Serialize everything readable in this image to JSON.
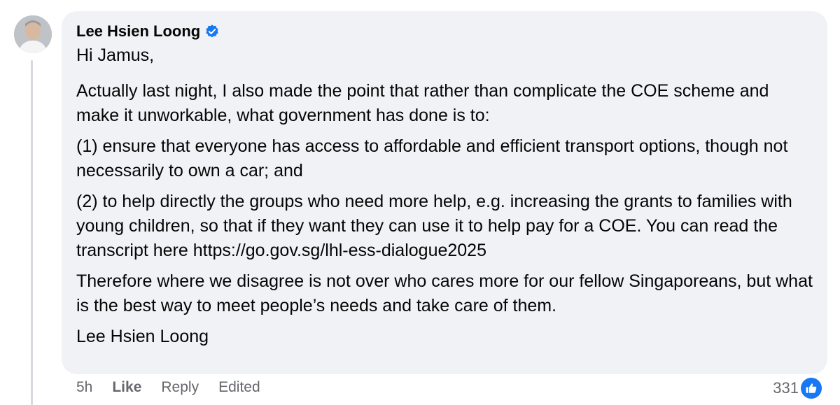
{
  "comment": {
    "author": "Lee Hsien Loong",
    "verified_icon": "verified-badge-icon",
    "paragraphs": [
      "Hi Jamus,",
      "Actually last night, I also made the point that rather than complicate the COE scheme and make it unworkable, what government has done is to:",
      "(1) ensure that everyone has access to affordable and efficient transport options, though not necessarily to own a car; and",
      "(2) to help directly the groups who need more help, e.g. increasing the grants to families with young children, so that if they want they can use it to help pay for a COE. You can read the transcript here https://go.gov.sg/lhl-ess-dialogue2025",
      "Therefore where we disagree is not over who cares more for our fellow Singaporeans, but what is the best way to meet people’s needs and take care of them.",
      "Lee Hsien Loong"
    ]
  },
  "actions": {
    "time": "5h",
    "like": "Like",
    "reply": "Reply",
    "edited": "Edited"
  },
  "reactions": {
    "count": "331",
    "icon": "thumbs-up-icon",
    "color": "#1877f2"
  }
}
